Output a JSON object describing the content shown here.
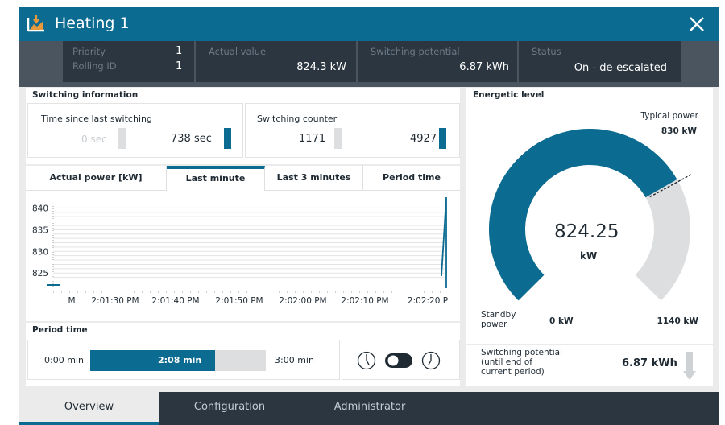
{
  "window": {
    "title": "Heating 1",
    "icon": "heating-icon"
  },
  "status": {
    "priority_label": "Priority",
    "priority_value": "1",
    "rolling_label": "Rolling ID",
    "rolling_value": "1",
    "actual_label": "Actual value",
    "actual_value": "824.3 kW",
    "potential_label": "Switching potential",
    "potential_value": "6.87 kWh",
    "status_label": "Status",
    "status_value": "On - de-escalated"
  },
  "switching": {
    "heading": "Switching information",
    "time_label": "Time since last switching",
    "time_min": "0 sec",
    "time_value": "738 sec",
    "counter_label": "Switching counter",
    "counter_min": "1171",
    "counter_value": "4927"
  },
  "chart_tabs": {
    "actual_power": "Actual power [kW]",
    "last_minute": "Last minute",
    "last_3_minutes": "Last 3 minutes",
    "period_time": "Period time"
  },
  "chart_data": {
    "type": "line",
    "ylim": [
      823,
      841
    ],
    "y_ticks": [
      "840",
      "835",
      "830",
      "825"
    ],
    "x_ticks": [
      "M",
      "2:01:30 PM",
      "2:01:40 PM",
      "2:01:50 PM",
      "2:02:00 PM",
      "2:02:10 PM",
      "2:02:20 P"
    ],
    "series": [
      {
        "values": [
          824.3,
          824.3,
          824.3,
          824.3,
          824.3,
          824.3,
          824.3
        ]
      }
    ],
    "grid": true
  },
  "period": {
    "heading": "Period time",
    "start": "0:00 min",
    "current": "2:08 min",
    "end": "3:00 min",
    "progress_fraction": 0.711
  },
  "energetic": {
    "heading": "Energetic level",
    "typical_label": "Typical power",
    "typical_value": "830 kW",
    "value": "824.25",
    "unit": "kW",
    "standby_label_1": "Standby",
    "standby_label_2": "power",
    "min_value": "0 kW",
    "max_value": "1140 kW",
    "gauge_min": 0,
    "gauge_max": 1140,
    "gauge_value": 824.25,
    "gauge_typical": 830,
    "potential_label_1": "Switching potential",
    "potential_label_2": "(until end of",
    "potential_label_3": "current period)",
    "potential_value": "6.87 kWh"
  },
  "nav": {
    "overview": "Overview",
    "configuration": "Configuration",
    "administrator": "Administrator"
  },
  "colors": {
    "accent": "#0b6b91",
    "dark": "#2b3640",
    "gray": "#dcdedf"
  }
}
